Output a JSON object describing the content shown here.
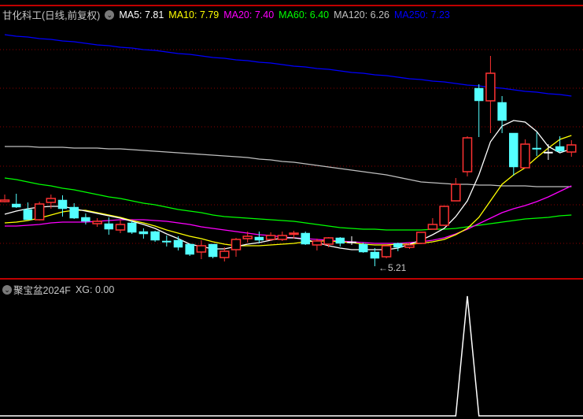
{
  "main_panel": {
    "title": "甘化科工(日线,前复权)",
    "ma_legend": [
      {
        "label": "MA5: 7.81",
        "color": "#ffffff"
      },
      {
        "label": "MA10: 7.79",
        "color": "#ffff00"
      },
      {
        "label": "MA20: 7.40",
        "color": "#ff00ff"
      },
      {
        "label": "MA60: 6.40",
        "color": "#00ff00"
      },
      {
        "label": "MA120: 6.26",
        "color": "#c0c0c0"
      },
      {
        "label": "MA250: 7.23",
        "color": "#0000ff"
      }
    ],
    "low_marker": {
      "arrow": "←",
      "value": "5.21"
    }
  },
  "sub_panel": {
    "title": "聚宝盆2024F",
    "value_label": "XG: 0.00"
  },
  "colors": {
    "up": "#ff3232",
    "down": "#54ffff",
    "flat": "#ffffff",
    "grid": "#8b0000",
    "separator": "#c00000"
  },
  "chart_data": {
    "type": "candlestick",
    "price_range": [
      5.09,
      8.59
    ],
    "grid_prices": [
      7.96,
      7.47,
      6.98,
      6.48,
      5.99,
      5.5
    ],
    "candles": [
      [
        6.03,
        6.12,
        6.02,
        6.05
      ],
      [
        6.0,
        6.13,
        5.95,
        5.96
      ],
      [
        5.93,
        6.02,
        5.8,
        5.8
      ],
      [
        5.8,
        6.03,
        5.79,
        6.0
      ],
      [
        6.02,
        6.12,
        5.94,
        6.07
      ],
      [
        6.05,
        6.11,
        5.84,
        5.94
      ],
      [
        5.96,
        6.01,
        5.81,
        5.82
      ],
      [
        5.83,
        5.88,
        5.74,
        5.78
      ],
      [
        5.75,
        5.82,
        5.71,
        5.78
      ],
      [
        5.75,
        5.83,
        5.61,
        5.68
      ],
      [
        5.67,
        5.8,
        5.63,
        5.74
      ],
      [
        5.76,
        5.79,
        5.62,
        5.64
      ],
      [
        5.65,
        5.69,
        5.56,
        5.62
      ],
      [
        5.65,
        5.66,
        5.52,
        5.54
      ],
      [
        5.53,
        5.6,
        5.46,
        5.52
      ],
      [
        5.54,
        5.59,
        5.41,
        5.45
      ],
      [
        5.49,
        5.49,
        5.34,
        5.36
      ],
      [
        5.39,
        5.54,
        5.3,
        5.47
      ],
      [
        5.49,
        5.49,
        5.31,
        5.33
      ],
      [
        5.32,
        5.45,
        5.27,
        5.4
      ],
      [
        5.42,
        5.57,
        5.33,
        5.55
      ],
      [
        5.56,
        5.65,
        5.51,
        5.59
      ],
      [
        5.58,
        5.65,
        5.5,
        5.54
      ],
      [
        5.55,
        5.64,
        5.53,
        5.6
      ],
      [
        5.55,
        5.65,
        5.53,
        5.6
      ],
      [
        5.62,
        5.66,
        5.56,
        5.63
      ],
      [
        5.63,
        5.65,
        5.48,
        5.49
      ],
      [
        5.48,
        5.56,
        5.41,
        5.53
      ],
      [
        5.49,
        5.58,
        5.45,
        5.57
      ],
      [
        5.57,
        5.58,
        5.46,
        5.5
      ],
      [
        5.52,
        5.59,
        5.48,
        5.52
      ],
      [
        5.49,
        5.51,
        5.38,
        5.39
      ],
      [
        5.39,
        5.44,
        5.21,
        5.31
      ],
      [
        5.33,
        5.47,
        5.31,
        5.47
      ],
      [
        5.5,
        5.51,
        5.4,
        5.45
      ],
      [
        5.45,
        5.51,
        5.43,
        5.48
      ],
      [
        5.5,
        5.64,
        5.49,
        5.64
      ],
      [
        5.68,
        5.82,
        5.68,
        5.74
      ],
      [
        5.73,
        5.98,
        5.72,
        5.97
      ],
      [
        6.04,
        6.33,
        6.04,
        6.25
      ],
      [
        6.41,
        6.86,
        6.35,
        6.84
      ],
      [
        7.47,
        7.52,
        6.85,
        7.31
      ],
      [
        7.31,
        7.88,
        6.9,
        7.66
      ],
      [
        7.29,
        7.37,
        6.9,
        7.06
      ],
      [
        6.9,
        6.9,
        6.36,
        6.47
      ],
      [
        6.46,
        6.82,
        6.46,
        6.76
      ],
      [
        6.71,
        6.91,
        6.61,
        6.7
      ],
      [
        6.66,
        6.76,
        6.56,
        6.66
      ],
      [
        6.73,
        6.86,
        6.65,
        6.67
      ],
      [
        6.66,
        6.81,
        6.6,
        6.75
      ]
    ],
    "candle_fields": [
      "open",
      "high",
      "low",
      "close"
    ],
    "ma": [
      {
        "name": "MA5",
        "color": "#ffffff",
        "values": [
          5.87,
          5.91,
          5.94,
          5.96,
          5.97,
          5.97,
          5.94,
          5.91,
          5.88,
          5.85,
          5.82,
          5.78,
          5.74,
          5.69,
          5.62,
          5.56,
          5.49,
          5.46,
          5.43,
          5.43,
          5.46,
          5.49,
          5.51,
          5.54,
          5.57,
          5.57,
          5.55,
          5.51,
          5.47,
          5.44,
          5.42,
          5.42,
          5.42,
          5.42,
          5.44,
          5.49,
          5.54,
          5.61,
          5.69,
          5.84,
          6.04,
          6.37,
          6.79,
          6.99,
          7.06,
          7.04,
          6.92,
          6.73,
          6.65,
          6.7
        ]
      },
      {
        "name": "MA10",
        "color": "#ffff00",
        "values": [
          5.76,
          5.77,
          5.79,
          5.82,
          5.86,
          5.9,
          5.92,
          5.92,
          5.89,
          5.86,
          5.83,
          5.79,
          5.76,
          5.72,
          5.67,
          5.63,
          5.59,
          5.56,
          5.52,
          5.49,
          5.47,
          5.47,
          5.47,
          5.48,
          5.49,
          5.5,
          5.52,
          5.53,
          5.53,
          5.52,
          5.51,
          5.49,
          5.48,
          5.48,
          5.49,
          5.49,
          5.5,
          5.52,
          5.55,
          5.61,
          5.69,
          5.83,
          6.04,
          6.25,
          6.37,
          6.46,
          6.59,
          6.71,
          6.82,
          6.87
        ]
      },
      {
        "name": "MA20",
        "color": "#ff00ff",
        "values": [
          5.72,
          5.72,
          5.73,
          5.74,
          5.76,
          5.77,
          5.77,
          5.77,
          5.78,
          5.79,
          5.8,
          5.8,
          5.8,
          5.79,
          5.78,
          5.76,
          5.74,
          5.71,
          5.69,
          5.67,
          5.65,
          5.63,
          5.61,
          5.6,
          5.58,
          5.57,
          5.56,
          5.55,
          5.54,
          5.53,
          5.52,
          5.51,
          5.5,
          5.5,
          5.5,
          5.51,
          5.52,
          5.54,
          5.57,
          5.62,
          5.68,
          5.75,
          5.82,
          5.89,
          5.94,
          5.98,
          6.03,
          6.09,
          6.16,
          6.23
        ]
      },
      {
        "name": "MA60",
        "color": "#00ff00",
        "values": [
          6.33,
          6.31,
          6.28,
          6.25,
          6.23,
          6.2,
          6.18,
          6.15,
          6.12,
          6.09,
          6.07,
          6.04,
          6.01,
          5.99,
          5.96,
          5.93,
          5.91,
          5.89,
          5.86,
          5.84,
          5.83,
          5.82,
          5.81,
          5.8,
          5.79,
          5.78,
          5.76,
          5.74,
          5.72,
          5.7,
          5.69,
          5.68,
          5.68,
          5.67,
          5.67,
          5.67,
          5.67,
          5.68,
          5.68,
          5.69,
          5.71,
          5.73,
          5.75,
          5.77,
          5.79,
          5.81,
          5.82,
          5.83,
          5.85,
          5.86
        ]
      },
      {
        "name": "MA120",
        "color": "#c0c0c0",
        "values": [
          6.73,
          6.73,
          6.73,
          6.72,
          6.72,
          6.72,
          6.71,
          6.71,
          6.71,
          6.7,
          6.7,
          6.69,
          6.68,
          6.67,
          6.66,
          6.65,
          6.64,
          6.63,
          6.62,
          6.61,
          6.6,
          6.59,
          6.57,
          6.56,
          6.54,
          6.53,
          6.51,
          6.49,
          6.47,
          6.45,
          6.43,
          6.41,
          6.39,
          6.37,
          6.34,
          6.31,
          6.28,
          6.27,
          6.26,
          6.25,
          6.25,
          6.24,
          6.24,
          6.23,
          6.23,
          6.23,
          6.22,
          6.22,
          6.22,
          6.22
        ]
      },
      {
        "name": "MA250",
        "color": "#0000ff",
        "values": [
          8.15,
          8.13,
          8.12,
          8.1,
          8.09,
          8.07,
          8.06,
          8.04,
          8.02,
          8.01,
          7.99,
          7.98,
          7.96,
          7.95,
          7.93,
          7.91,
          7.9,
          7.88,
          7.86,
          7.85,
          7.83,
          7.82,
          7.8,
          7.79,
          7.77,
          7.75,
          7.74,
          7.72,
          7.71,
          7.69,
          7.67,
          7.66,
          7.64,
          7.63,
          7.61,
          7.59,
          7.58,
          7.56,
          7.55,
          7.53,
          7.51,
          7.5,
          7.48,
          7.47,
          7.45,
          7.43,
          7.42,
          7.4,
          7.39,
          7.37
        ]
      }
    ],
    "xg": {
      "range": [
        0,
        1
      ],
      "values": [
        0,
        0,
        0,
        0,
        0,
        0,
        0,
        0,
        0,
        0,
        0,
        0,
        0,
        0,
        0,
        0,
        0,
        0,
        0,
        0,
        0,
        0,
        0,
        0,
        0,
        0,
        0,
        0,
        0,
        0,
        0,
        0,
        0,
        0,
        0,
        0,
        0,
        0,
        0,
        0,
        1,
        0,
        0,
        0,
        0,
        0,
        0,
        0,
        0,
        0
      ]
    }
  }
}
